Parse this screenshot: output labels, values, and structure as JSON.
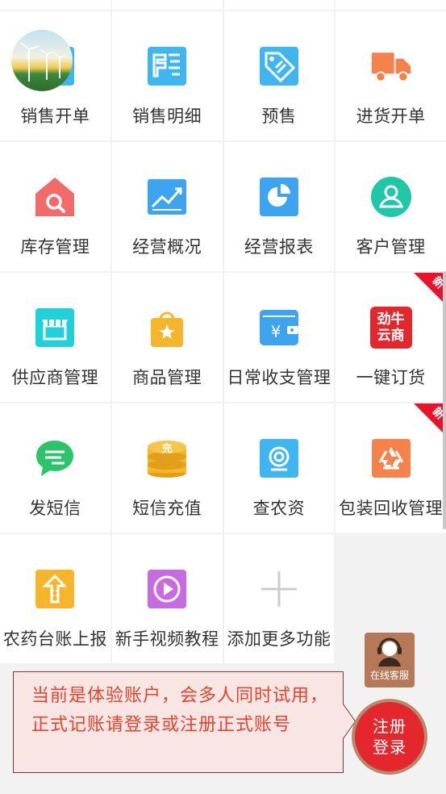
{
  "grid": {
    "items": [
      {
        "label": "销售开单",
        "icon": "sales-order-icon",
        "color": "#3fb6f0"
      },
      {
        "label": "销售明细",
        "icon": "sales-detail-icon",
        "color": "#3fb6f0"
      },
      {
        "label": "预售",
        "icon": "presale-tag-icon",
        "color": "#3fb6f0"
      },
      {
        "label": "进货开单",
        "icon": "truck-icon",
        "color": "#f5824a"
      },
      {
        "label": "库存管理",
        "icon": "inventory-house-icon",
        "color": "#f26b6b"
      },
      {
        "label": "经营概况",
        "icon": "trend-chart-icon",
        "color": "#3fa4f0"
      },
      {
        "label": "经营报表",
        "icon": "pie-report-icon",
        "color": "#3fa4f0"
      },
      {
        "label": "客户管理",
        "icon": "customer-icon",
        "color": "#1fc7a8"
      },
      {
        "label": "供应商管理",
        "icon": "supplier-store-icon",
        "color": "#1fd1d9"
      },
      {
        "label": "商品管理",
        "icon": "product-bag-icon",
        "color": "#f7b52c"
      },
      {
        "label": "日常收支管理",
        "icon": "wallet-icon",
        "color": "#3fa4f0"
      },
      {
        "label": "一键订货",
        "icon": "jinniu-yunshang-icon",
        "color": "#e4262d",
        "badge": "新",
        "icon_text": [
          "劲牛",
          "云商"
        ]
      },
      {
        "label": "发短信",
        "icon": "sms-bubble-icon",
        "color": "#2cc46b"
      },
      {
        "label": "短信充值",
        "icon": "coins-icon",
        "color": "#f7b52c",
        "icon_text": [
          "充"
        ]
      },
      {
        "label": "查农资",
        "icon": "search-agri-icon",
        "color": "#3fb6f0"
      },
      {
        "label": "包装回收管理",
        "icon": "recycle-icon",
        "color": "#f5824a",
        "badge": "新"
      },
      {
        "label": "农药台账上报",
        "icon": "upload-report-icon",
        "color": "#f7b52c"
      },
      {
        "label": "新手视频教程",
        "icon": "video-play-icon",
        "color": "#c86be0"
      },
      {
        "label": "添加更多功能",
        "icon": "plus-icon",
        "color": "#cccccc"
      }
    ]
  },
  "notice": {
    "text": "当前是体验账户，会多人同时试用，正式记账请登录或注册正式账号"
  },
  "service": {
    "label": "在线客服",
    "icon": "headset-agent-icon"
  },
  "login_button": {
    "line1": "注册",
    "line2": "登录"
  },
  "colors": {
    "accent_red": "#e4262d",
    "notice_text": "#e8432c",
    "service_bg": "#b57958"
  }
}
